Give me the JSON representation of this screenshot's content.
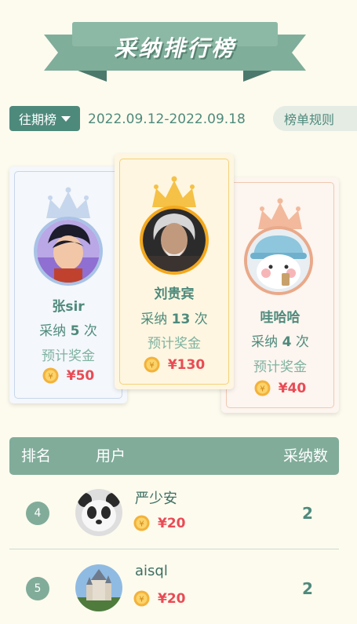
{
  "header": {
    "title": "采纳排行榜"
  },
  "filters": {
    "period_label": "往期榜",
    "date_range": "2022.09.12-2022.09.18",
    "rules_label": "榜单规则"
  },
  "podium": [
    {
      "rank": 2,
      "name": "张sir",
      "count_prefix": "采纳",
      "count": "5",
      "count_suffix": "次",
      "prize_label": "预计奖金",
      "prize": "¥50"
    },
    {
      "rank": 1,
      "name": "刘贵宾",
      "count_prefix": "采纳",
      "count": "13",
      "count_suffix": "次",
      "prize_label": "预计奖金",
      "prize": "¥130"
    },
    {
      "rank": 3,
      "name": "哇哈哈",
      "count_prefix": "采纳",
      "count": "4",
      "count_suffix": "次",
      "prize_label": "预计奖金",
      "prize": "¥40"
    }
  ],
  "table": {
    "headers": {
      "rank": "排名",
      "user": "用户",
      "count": "采纳数"
    },
    "rows": [
      {
        "rank": "4",
        "name": "严少安",
        "prize": "¥20",
        "count": "2"
      },
      {
        "rank": "5",
        "name": "aisql",
        "prize": "¥20",
        "count": "2"
      }
    ]
  },
  "colors": {
    "accent": "#4e8a7c",
    "header": "#81ac9a",
    "price": "#e94b55",
    "background": "#fdfbee"
  }
}
